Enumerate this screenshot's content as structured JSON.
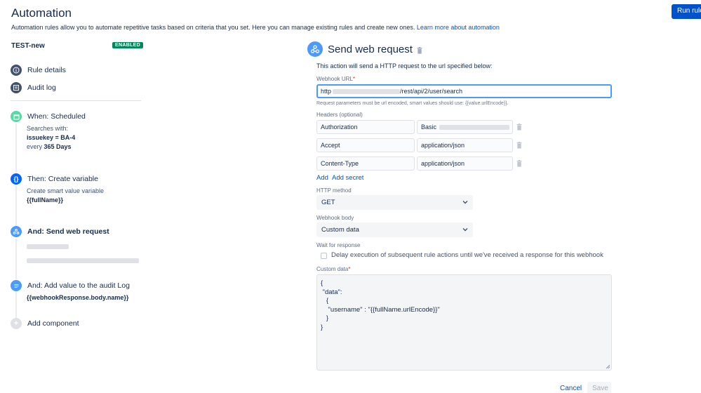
{
  "header": {
    "title": "Automation",
    "intro": "Automation rules allow you to automate repetitive tasks based on criteria that you set. Here you can manage existing rules and create new ones.",
    "learn_more": "Learn more about automation",
    "run_rule": "Run rule"
  },
  "rule": {
    "name": "TEST-new",
    "status": "ENABLED"
  },
  "nav": {
    "rule_details": "Rule details",
    "audit_log": "Audit log"
  },
  "components": {
    "trigger": {
      "title": "When: Scheduled",
      "line1": "Searches with:",
      "line2": "issuekey = BA-4",
      "line3_prefix": "every",
      "line3_value": "365 Days"
    },
    "variable": {
      "title": "Then: Create variable",
      "line1": "Create smart value variable",
      "line2": "{{fullName}}"
    },
    "web_request": {
      "title": "And: Send web request"
    },
    "log": {
      "title": "And: Add value to the audit Log",
      "line1": "{{webhookResponse.body.name}}"
    },
    "add": "Add component"
  },
  "action": {
    "title": "Send web request",
    "description": "This action will send a HTTP request to the url specified below:",
    "webhook_url_label": "Webhook URL",
    "webhook_url_prefix": "http",
    "webhook_url_suffix": "/rest/api/2/user/search",
    "url_hint": "Request parameters must be url encoded, smart values should use: {{value.urlEncode}}.",
    "headers_label": "Headers (optional)",
    "headers": [
      {
        "key": "Authorization",
        "value": "Basic"
      },
      {
        "key": "Accept",
        "value": "application/json"
      },
      {
        "key": "Content-Type",
        "value": "application/json"
      }
    ],
    "add": "Add",
    "add_secret": "Add secret",
    "method_label": "HTTP method",
    "method": "GET",
    "body_label": "Webhook body",
    "body": "Custom data",
    "wait_label": "Wait for response",
    "wait_checkbox": "Delay execution of subsequent rule actions until we've received a response for this webhook",
    "custom_data_label": "Custom data",
    "custom_data": "{\n \"data\":\n   {\n    \"username\" : \"{{fullName.urlEncode}}\"\n   }\n}",
    "cancel": "Cancel",
    "save": "Save"
  },
  "colors": {
    "primary": "#0052CC",
    "enabled": "#00875A",
    "trigger": "#57D9A3",
    "action": "#4C9AFF",
    "variable": "#0065FF"
  }
}
